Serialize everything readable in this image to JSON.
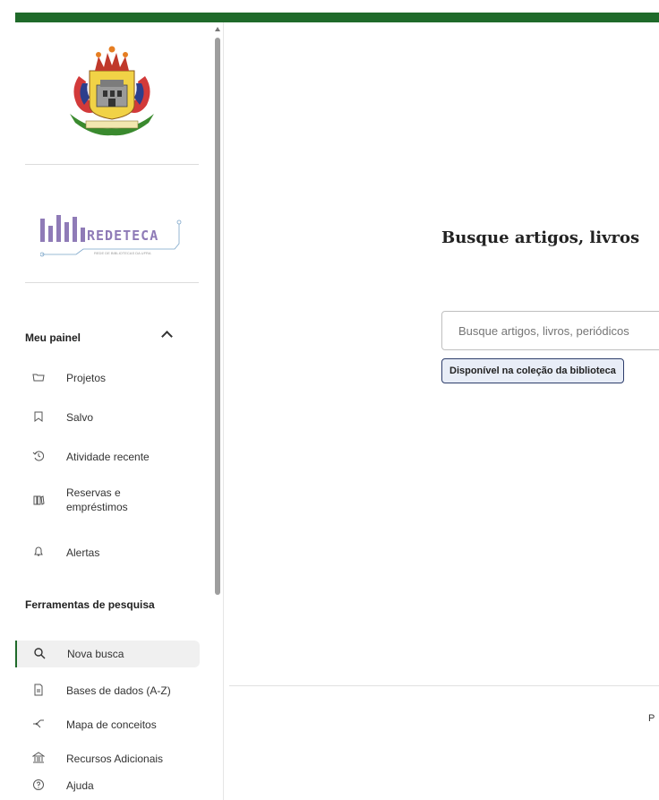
{
  "sidebar": {
    "panel_heading": "Meu painel",
    "panel_items": [
      {
        "label": "Projetos",
        "icon": "folder-icon"
      },
      {
        "label": "Salvo",
        "icon": "bookmark-icon"
      },
      {
        "label": "Atividade recente",
        "icon": "history-icon"
      },
      {
        "label": "Reservas e empréstimos",
        "icon": "books-icon"
      },
      {
        "label": "Alertas",
        "icon": "bell-icon"
      }
    ],
    "tools_heading": "Ferramentas de pesquisa",
    "tools_items": [
      {
        "label": "Nova busca",
        "icon": "search-icon"
      },
      {
        "label": "Bases de dados (A-Z)",
        "icon": "document-icon"
      },
      {
        "label": "Mapa de conceitos",
        "icon": "concept-map-icon"
      },
      {
        "label": "Recursos Adicionais",
        "icon": "library-building-icon"
      },
      {
        "label": "Ajuda",
        "icon": "help-icon"
      }
    ]
  },
  "logo": {
    "text": "REDETECA",
    "subtitle": "REDE DE BIBLIOTECAS DA UFRA"
  },
  "main": {
    "title": "Busque artigos, livros",
    "search_placeholder": "Busque artigos, livros, periódicos",
    "filter_chip": "Disponível na coleção da biblioteca"
  },
  "footer": {
    "text": "P"
  },
  "colors": {
    "topbar": "#1f6a2a",
    "logo": "#8f7bb7",
    "chip_bg": "#e8edf7",
    "chip_border": "#2d3d6b"
  }
}
